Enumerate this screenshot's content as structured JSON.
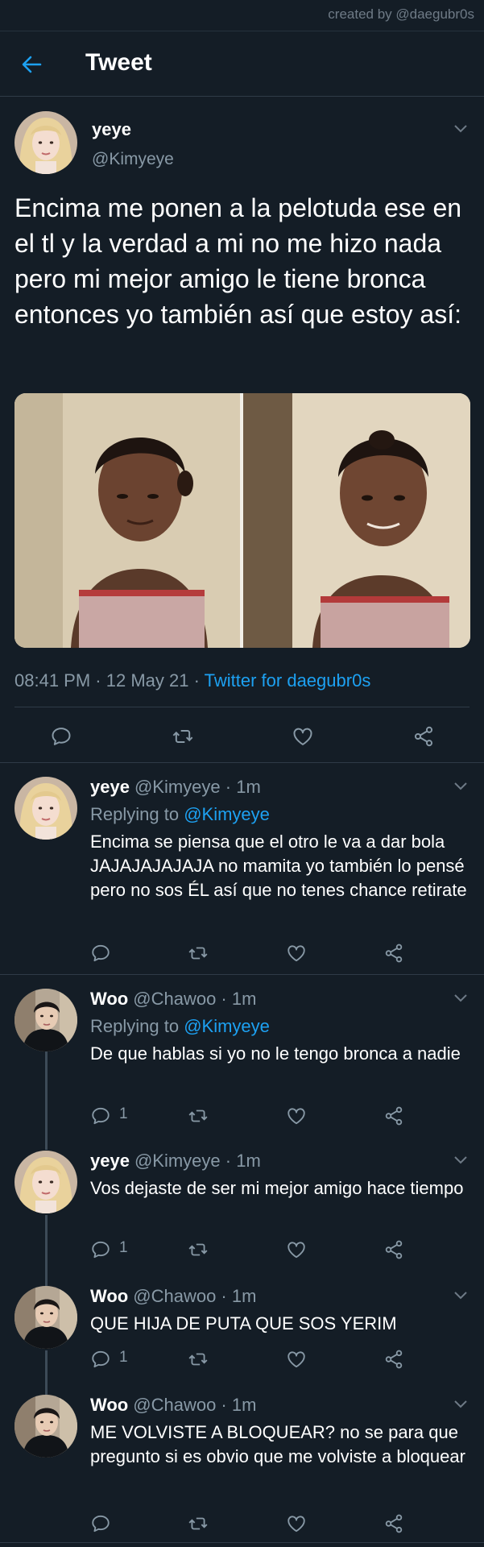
{
  "credit": "created by @daegubr0s",
  "header": {
    "title": "Tweet"
  },
  "main_tweet": {
    "name": "yeye",
    "handle": "@Kimyeye",
    "text": "Encima me ponen a la pelotuda ese en el tl y la verdad a mi no me hizo nada pero mi mejor amigo le tiene bronca entonces yo también así que estoy así:",
    "time": "08:41 PM",
    "date": "12 May 21",
    "source": "Twitter for daegubr0s"
  },
  "replies": [
    {
      "name": "yeye",
      "handle": "@Kimyeye",
      "time": "1m",
      "replying_label": "Replying to",
      "replying_to": "@Kimyeye",
      "text": "Encima se piensa que el otro le va a dar bola JAJAJAJAJAJA no mamita yo también lo pensé pero no sos ÉL así que no tenes chance retirate",
      "reply_count": ""
    },
    {
      "name": "Woo",
      "handle": "@Chawoo",
      "time": "1m",
      "replying_label": "Replying to",
      "replying_to": "@Kimyeye",
      "text": "De que hablas si yo no le tengo bronca a nadie",
      "reply_count": "1"
    },
    {
      "name": "yeye",
      "handle": "@Kimyeye",
      "time": "1m",
      "text": "Vos dejaste de ser mi mejor amigo hace tiempo",
      "reply_count": "1"
    },
    {
      "name": "Woo",
      "handle": "@Chawoo",
      "time": "1m",
      "text": "QUE HIJA DE PUTA QUE SOS YERIM",
      "reply_count": "1"
    },
    {
      "name": "Woo",
      "handle": "@Chawoo",
      "time": "1m",
      "text": "ME VOLVISTE A BLOQUEAR? no se para que pregunto si es obvio que me volviste a bloquear",
      "reply_count": ""
    }
  ],
  "colors": {
    "background": "#141d26",
    "accent": "#1da1f2",
    "muted": "#8899a6",
    "divider": "#2f3b47"
  },
  "icons": [
    "back-arrow-icon",
    "chevron-down-icon",
    "reply-icon",
    "retweet-icon",
    "like-icon",
    "share-icon"
  ]
}
